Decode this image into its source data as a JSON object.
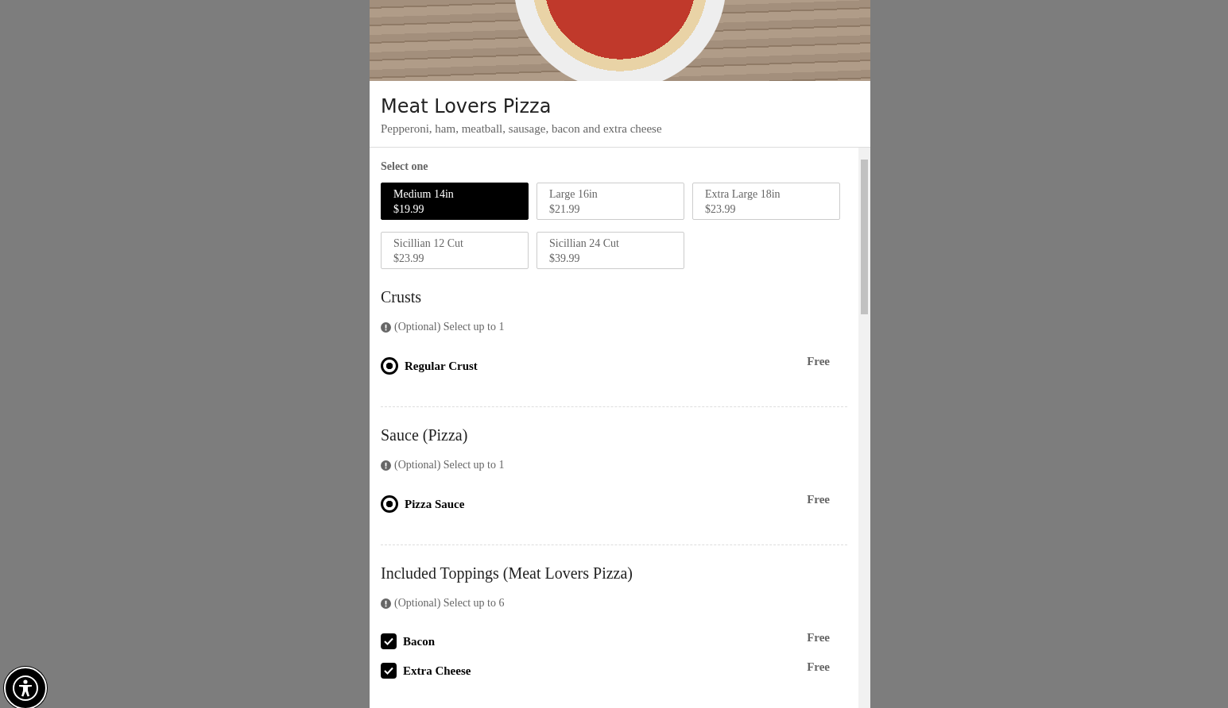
{
  "item": {
    "title": "Meat Lovers Pizza",
    "description": "Pepperoni, ham, meatball, sausage, bacon and extra cheese"
  },
  "size_group": {
    "label": "Select one",
    "options": [
      {
        "name": "Medium 14in",
        "price": "$19.99",
        "selected": true
      },
      {
        "name": "Large 16in",
        "price": "$21.99",
        "selected": false
      },
      {
        "name": "Extra Large 18in",
        "price": "$23.99",
        "selected": false
      },
      {
        "name": "Sicillian 12 Cut",
        "price": "$23.99",
        "selected": false
      },
      {
        "name": "Sicillian 24 Cut",
        "price": "$39.99",
        "selected": false
      }
    ]
  },
  "sections": [
    {
      "title": "Crusts",
      "hint": "(Optional) Select up to 1",
      "options": [
        {
          "kind": "radio",
          "label": "Regular Crust",
          "price": "Free",
          "checked": true
        }
      ]
    },
    {
      "title": "Sauce (Pizza)",
      "hint": "(Optional) Select up to 1",
      "options": [
        {
          "kind": "radio",
          "label": "Pizza Sauce",
          "price": "Free",
          "checked": true
        }
      ]
    },
    {
      "title": "Included Toppings (Meat Lovers Pizza)",
      "hint": "(Optional) Select up to 6",
      "options": [
        {
          "kind": "checkbox",
          "label": "Bacon",
          "price": "Free",
          "checked": true
        },
        {
          "kind": "checkbox",
          "label": "Extra Cheese",
          "price": "Free",
          "checked": true
        }
      ]
    }
  ]
}
